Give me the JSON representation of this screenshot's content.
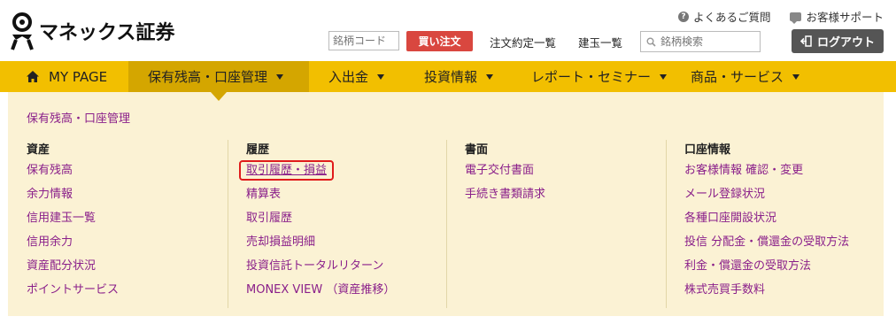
{
  "brand": {
    "name": "マネックス証券"
  },
  "top_links": [
    {
      "label": "よくあるご質問",
      "icon": "question-icon"
    },
    {
      "label": "お客様サポート",
      "icon": "chat-icon"
    }
  ],
  "toolbar": {
    "code_placeholder": "銘柄コード",
    "buy_label": "買い注文",
    "orders_label": "注文約定一覧",
    "positions_label": "建玉一覧",
    "search_placeholder": "銘柄検索",
    "logout_label": "ログアウト"
  },
  "nav": [
    {
      "label": "MY PAGE"
    },
    {
      "label": "保有残高・口座管理"
    },
    {
      "label": "入出金"
    },
    {
      "label": "投資情報"
    },
    {
      "label": "レポート・セミナー"
    },
    {
      "label": "商品・サービス"
    }
  ],
  "panel": {
    "title": "保有残高・口座管理",
    "columns": [
      {
        "heading": "資産",
        "links": [
          "保有残高",
          "余力情報",
          "信用建玉一覧",
          "信用余力",
          "資産配分状況",
          "ポイントサービス"
        ]
      },
      {
        "heading": "履歴",
        "links": [
          "取引履歴・損益",
          "精算表",
          "取引履歴",
          "売却損益明細",
          "投資信託トータルリターン",
          "MONEX VIEW （資産推移）"
        ]
      },
      {
        "heading": "書面",
        "links": [
          "電子交付書面",
          "手続き書類請求"
        ]
      },
      {
        "heading": "口座情報",
        "links": [
          "お客様情報 確認・変更",
          "メール登録状況",
          "各種口座開設状況",
          "投信 分配金・償還金の受取方法",
          "利金・償還金の受取方法",
          "株式売買手数料"
        ]
      }
    ]
  },
  "colors": {
    "nav_bg": "#f2bf00",
    "nav_active": "#d4a600",
    "panel_bg": "#fbf2d4",
    "link": "#8a1f8a",
    "buy": "#d9473f",
    "logout": "#555555"
  }
}
